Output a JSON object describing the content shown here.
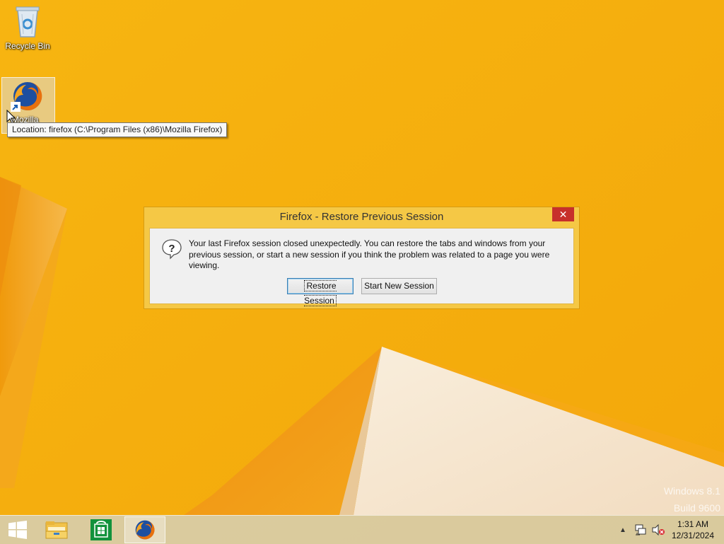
{
  "desktop": {
    "icons": [
      {
        "label": "Recycle Bin"
      },
      {
        "label": "Mozilla"
      }
    ],
    "tooltip": "Location: firefox (C:\\Program Files (x86)\\Mozilla Firefox)"
  },
  "dialog": {
    "title": "Firefox - Restore Previous Session",
    "close_glyph": "✕",
    "message": "Your last Firefox session closed unexpectedly. You can restore the tabs and windows from your previous session, or start a new session if you think the problem was related to a page you were viewing.",
    "restore_label": "Restore Session",
    "new_session_label": "Start New Session"
  },
  "watermark": {
    "line1": "Windows 8.1",
    "line2": "Build 9600"
  },
  "taskbar": {
    "items": [
      "start-icon",
      "file-explorer-icon",
      "store-icon",
      "firefox-icon"
    ],
    "tray_chevron": "▲",
    "time": "1:31 AM",
    "date": "12/31/2024"
  },
  "colors": {
    "desktop_background": "#f5ae0c",
    "dialog_frame": "#f5c845",
    "close_button": "#c7302b"
  }
}
